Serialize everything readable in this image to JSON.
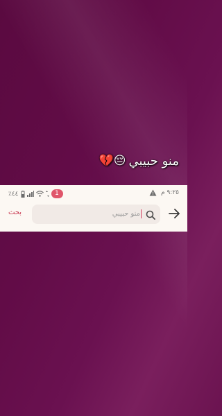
{
  "overlay": {
    "caption": "منو حبيبي",
    "emojis": "😔💔"
  },
  "status_bar": {
    "time": "٩:٢٥ م",
    "battery_percent": "٪٤٤",
    "notification_count": "1"
  },
  "search": {
    "query": "منو حبيبي",
    "action_label": "بحث"
  },
  "colors": {
    "background": "#620c47",
    "panel": "#fcf8f3",
    "accent": "#c8364f",
    "badge": "#e0556a"
  },
  "icons": [
    "warning-icon",
    "battery-icon",
    "signal-icon",
    "wifi-icon",
    "data-arrows-icon",
    "search-icon",
    "back-arrow-icon"
  ]
}
